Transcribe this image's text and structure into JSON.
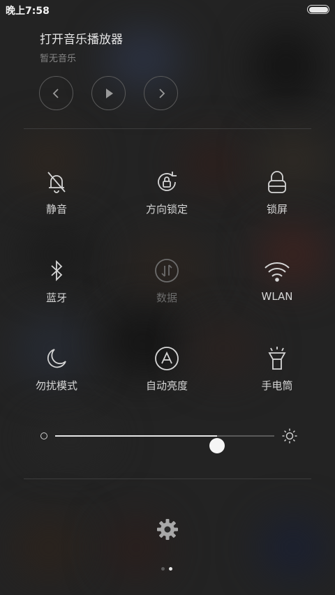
{
  "status_bar": {
    "time": "晚上7:58",
    "battery_level": 1.0
  },
  "music": {
    "title": "打开音乐播放器",
    "subtitle": "暂无音乐",
    "controls": [
      "previous-icon",
      "play-icon",
      "next-icon"
    ]
  },
  "toggles": [
    {
      "label": "静音",
      "icon": "bell-off-icon",
      "enabled": true
    },
    {
      "label": "方向锁定",
      "icon": "rotation-lock-icon",
      "enabled": true
    },
    {
      "label": "锁屏",
      "icon": "lock-icon",
      "enabled": true
    },
    {
      "label": "蓝牙",
      "icon": "bluetooth-icon",
      "enabled": true
    },
    {
      "label": "数据",
      "icon": "mobile-data-icon",
      "enabled": false
    },
    {
      "label": "WLAN",
      "icon": "wifi-icon",
      "enabled": true
    },
    {
      "label": "勿扰模式",
      "icon": "moon-icon",
      "enabled": true
    },
    {
      "label": "自动亮度",
      "icon": "auto-brightness-icon",
      "enabled": true
    },
    {
      "label": "手电筒",
      "icon": "flashlight-icon",
      "enabled": true
    }
  ],
  "brightness": {
    "level": 0.74
  },
  "settings_icon": "gear-icon",
  "pager": {
    "pages": 2,
    "current": 2
  },
  "colors": {
    "background": "#232323",
    "text": "#d6d6d6",
    "disabled_text": "#6c6c6c"
  }
}
